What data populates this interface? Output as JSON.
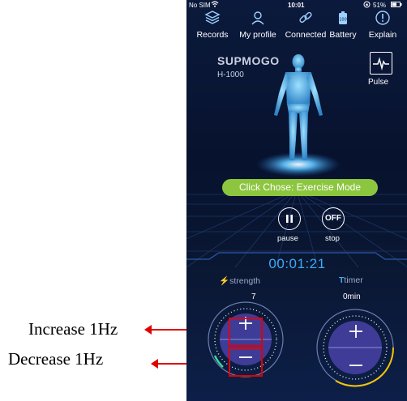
{
  "annotations": {
    "increase": "Increase 1Hz",
    "decrease": "Decrease 1Hz"
  },
  "status_bar": {
    "carrier": "No SIM",
    "time": "10:01",
    "battery": "51%"
  },
  "nav": [
    {
      "label": "Records",
      "icon": "stack-layers-icon"
    },
    {
      "label": "My profile",
      "icon": "person-icon"
    },
    {
      "label": "Connected",
      "icon": "link-icon"
    },
    {
      "label": "Battery",
      "icon": "battery-icon"
    },
    {
      "label": "Explain",
      "icon": "info-icon"
    }
  ],
  "device": {
    "brand": "SUPMOGO",
    "model": "H-1000"
  },
  "pulse_label": "Pulse",
  "mode_button": "Click Chose: Exercise Mode",
  "controls": {
    "pause_label": "pause",
    "stop_label": "stop",
    "stop_icon_text": "OFF"
  },
  "timer_display": "00:01:21",
  "strength": {
    "label": "strength",
    "value": "7",
    "glyph": "⚡"
  },
  "timer": {
    "label": "timer",
    "value": "0min",
    "glyph": "T"
  },
  "colors": {
    "accent_green": "#8cc63f",
    "accent_blue": "#3fa9f5",
    "timer_ring": "#f5c400",
    "annotation_red": "#e00000"
  }
}
